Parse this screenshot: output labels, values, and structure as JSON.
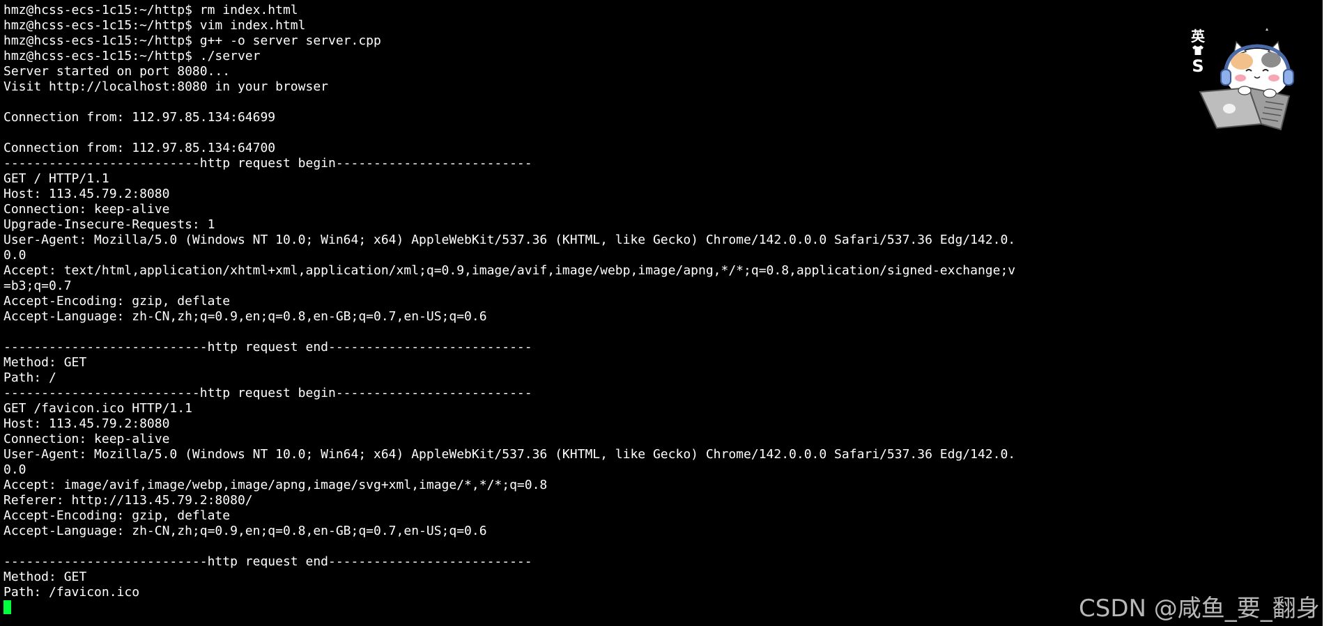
{
  "terminal": {
    "lines": [
      "hmz@hcss-ecs-1c15:~/http$ rm index.html",
      "hmz@hcss-ecs-1c15:~/http$ vim index.html",
      "hmz@hcss-ecs-1c15:~/http$ g++ -o server server.cpp",
      "hmz@hcss-ecs-1c15:~/http$ ./server",
      "Server started on port 8080...",
      "Visit http://localhost:8080 in your browser",
      "",
      "Connection from: 112.97.85.134:64699",
      "",
      "Connection from: 112.97.85.134:64700",
      "--------------------------http request begin--------------------------",
      "GET / HTTP/1.1",
      "Host: 113.45.79.2:8080",
      "Connection: keep-alive",
      "Upgrade-Insecure-Requests: 1",
      "User-Agent: Mozilla/5.0 (Windows NT 10.0; Win64; x64) AppleWebKit/537.36 (KHTML, like Gecko) Chrome/142.0.0.0 Safari/537.36 Edg/142.0.",
      "0.0",
      "Accept: text/html,application/xhtml+xml,application/xml;q=0.9,image/avif,image/webp,image/apng,*/*;q=0.8,application/signed-exchange;v",
      "=b3;q=0.7",
      "Accept-Encoding: gzip, deflate",
      "Accept-Language: zh-CN,zh;q=0.9,en;q=0.8,en-GB;q=0.7,en-US;q=0.6",
      "",
      "---------------------------http request end---------------------------",
      "Method: GET",
      "Path: /",
      "--------------------------http request begin--------------------------",
      "GET /favicon.ico HTTP/1.1",
      "Host: 113.45.79.2:8080",
      "Connection: keep-alive",
      "User-Agent: Mozilla/5.0 (Windows NT 10.0; Win64; x64) AppleWebKit/537.36 (KHTML, like Gecko) Chrome/142.0.0.0 Safari/537.36 Edg/142.0.",
      "0.0",
      "Accept: image/avif,image/webp,image/apng,image/svg+xml,image/*,*/*;q=0.8",
      "Referer: http://113.45.79.2:8080/",
      "Accept-Encoding: gzip, deflate",
      "Accept-Language: zh-CN,zh;q=0.9,en;q=0.8,en-GB;q=0.7,en-US;q=0.6",
      "",
      "---------------------------http request end---------------------------",
      "Method: GET",
      "Path: /favicon.ico"
    ],
    "cursor_color": "#00ff3c",
    "background": "#000000",
    "foreground": "#ffffff"
  },
  "ime_indicator": {
    "char": "英",
    "icon": "shirt-icon",
    "letter": "S"
  },
  "mascot": {
    "icon": "cat-with-laptop-icon"
  },
  "watermark": {
    "text": "CSDN @咸鱼_要_翻身"
  }
}
